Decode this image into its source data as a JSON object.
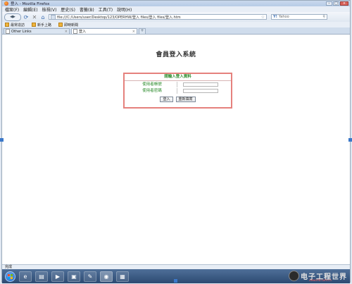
{
  "window": {
    "title": "登入 - Mozilla Firefox"
  },
  "menubar": {
    "items": [
      "檔案(F)",
      "編輯(E)",
      "檢視(V)",
      "歷史(S)",
      "書籤(B)",
      "工具(T)",
      "說明(H)"
    ]
  },
  "nav": {
    "url": "file:///C:/Users/user/Desktop/123/OPERHW/登入 files/登入 files/登入.htm",
    "search_value": "Yahoo"
  },
  "bookmarks": {
    "items": [
      "最常造訪",
      "新手上路",
      "即時新聞"
    ]
  },
  "tabs": [
    {
      "label": "Other Links"
    },
    {
      "label": "登入"
    }
  ],
  "page": {
    "heading": "會員登入系統",
    "login_box_title": "請輸入登入資料",
    "account_label": "使用者帳號",
    "password_label": "使用者密碼",
    "login_button": "登入",
    "reset_button": "重新填寫"
  },
  "statusbar": {
    "text": "完成"
  },
  "watermark": {
    "text": "电子工程世界",
    "url": "eeworld.com.cn"
  },
  "colors": {
    "form_border": "#e5817d",
    "label_green": "#2a8a2a",
    "taskbar": "#2c4a72"
  },
  "icons": [
    "firefox-icon",
    "back-icon",
    "forward-icon",
    "reload-icon",
    "stop-icon",
    "home-icon",
    "star-icon",
    "search-icon",
    "start-orb-icon",
    "ie-icon",
    "folder-icon",
    "media-icon",
    "firefox-taskbar-icon"
  ]
}
